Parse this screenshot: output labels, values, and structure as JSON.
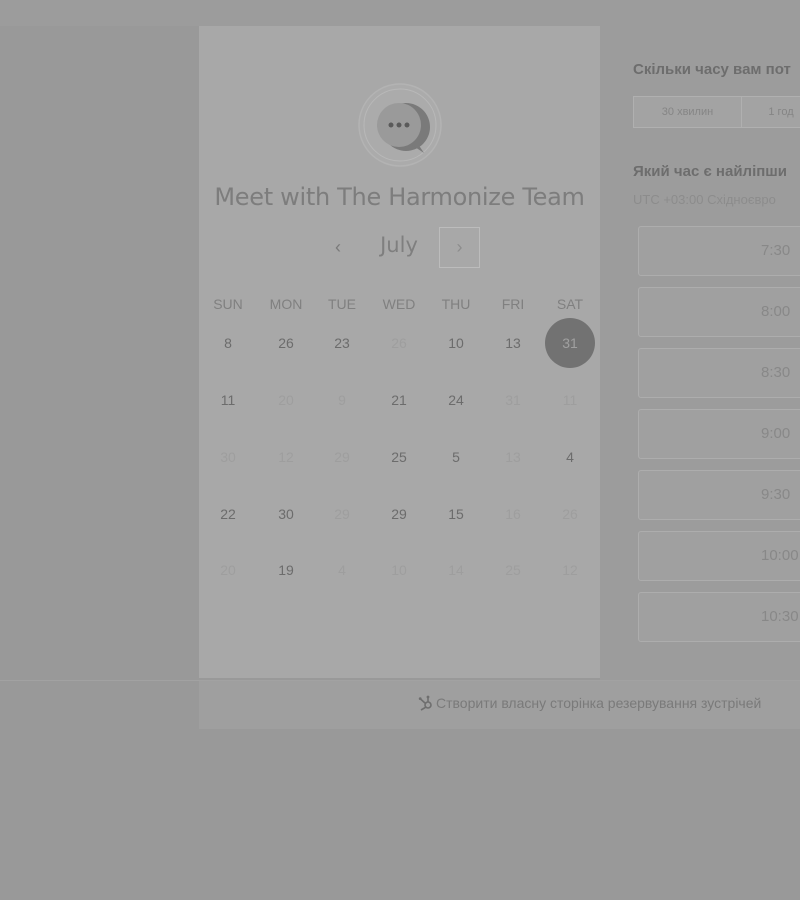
{
  "calendar": {
    "title": "Meet with The Harmonize Team",
    "month": "July",
    "prev_icon": "‹",
    "next_icon": "›",
    "weekdays": [
      "SUN",
      "MON",
      "TUE",
      "WED",
      "THU",
      "FRI",
      "SAT"
    ],
    "weeks": [
      [
        {
          "d": "8",
          "s": "active"
        },
        {
          "d": "26",
          "s": "active"
        },
        {
          "d": "23",
          "s": "active"
        },
        {
          "d": "26",
          "s": "dim"
        },
        {
          "d": "10",
          "s": "active"
        },
        {
          "d": "13",
          "s": "active"
        },
        {
          "d": "31",
          "s": "selected"
        }
      ],
      [
        {
          "d": "11",
          "s": "active"
        },
        {
          "d": "20",
          "s": "dim"
        },
        {
          "d": "9",
          "s": "dim"
        },
        {
          "d": "21",
          "s": "active"
        },
        {
          "d": "24",
          "s": "active"
        },
        {
          "d": "31",
          "s": "dim"
        },
        {
          "d": "11",
          "s": "dim"
        }
      ],
      [
        {
          "d": "30",
          "s": "dim"
        },
        {
          "d": "12",
          "s": "dim"
        },
        {
          "d": "29",
          "s": "dim"
        },
        {
          "d": "25",
          "s": "active"
        },
        {
          "d": "5",
          "s": "active"
        },
        {
          "d": "13",
          "s": "dim"
        },
        {
          "d": "4",
          "s": "active"
        }
      ],
      [
        {
          "d": "22",
          "s": "active"
        },
        {
          "d": "30",
          "s": "active"
        },
        {
          "d": "29",
          "s": "dim"
        },
        {
          "d": "29",
          "s": "active"
        },
        {
          "d": "15",
          "s": "active"
        },
        {
          "d": "16",
          "s": "dim"
        },
        {
          "d": "26",
          "s": "dim"
        }
      ],
      [
        {
          "d": "20",
          "s": "dim"
        },
        {
          "d": "19",
          "s": "active"
        },
        {
          "d": "4",
          "s": "dim"
        },
        {
          "d": "10",
          "s": "dim"
        },
        {
          "d": "14",
          "s": "dim"
        },
        {
          "d": "25",
          "s": "dim"
        },
        {
          "d": "12",
          "s": "dim"
        }
      ]
    ]
  },
  "booking": {
    "duration_question": "Скільки часу вам пот",
    "durations": [
      "30 хвилин",
      "1 год"
    ],
    "time_question": "Який час є найліпши",
    "timezone": "UTC +03:00 Східноєвро",
    "slots": [
      "7:30",
      "8:00",
      "8:30",
      "9:00",
      "9:30",
      "10:00",
      "10:30"
    ]
  },
  "footer": {
    "create_link": "Створити власну сторінка резервування зустрічей",
    "icon": "sprocket-icon"
  },
  "colors": {
    "background": "#999999",
    "card": "#a8a8a8",
    "selected_day": "#727272"
  }
}
